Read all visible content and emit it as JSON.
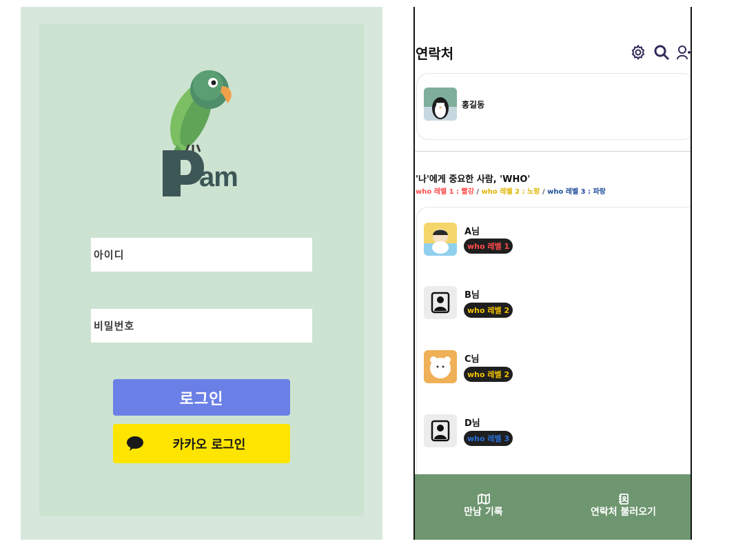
{
  "login": {
    "id_placeholder": "아이디",
    "password_placeholder": "비밀번호",
    "login_button": "로그인",
    "kakao_button": "카카오 로그인",
    "logo_text": "Pam",
    "colors": {
      "frame": "#d7e7dc",
      "panel": "#cde3d2",
      "login_button": "#6b80e6",
      "kakao_button": "#fee500"
    }
  },
  "contacts": {
    "title": "연락처",
    "header_icons": [
      "settings-icon",
      "search-icon",
      "add-user-icon"
    ],
    "profile": {
      "name": "홍길동",
      "avatar": "penguin-avatar"
    },
    "who_title": "'나'에게 중요한 사람, 'WHO'",
    "legend": {
      "level1": "who 레벨 1 : 빨강",
      "level2": "who 레벨 2 : 노랑",
      "level3": "who 레벨 3 : 파랑",
      "separator": " / "
    },
    "items": [
      {
        "name": "A님",
        "badge": "who 레벨 1",
        "badge_color": "#ff4b4b",
        "avatar": "child-avatar"
      },
      {
        "name": "B님",
        "badge": "who 레벨 2",
        "badge_color": "#f2c200",
        "avatar": "default-avatar"
      },
      {
        "name": "C님",
        "badge": "who 레벨 2",
        "badge_color": "#f2c200",
        "avatar": "bear-avatar"
      },
      {
        "name": "D님",
        "badge": "who 레벨 3",
        "badge_color": "#2a6fd6",
        "avatar": "default-avatar"
      }
    ],
    "nav": {
      "meet_record": "만남 기록",
      "load_contacts": "연락처 불러오기",
      "color": "#6e9670"
    }
  }
}
